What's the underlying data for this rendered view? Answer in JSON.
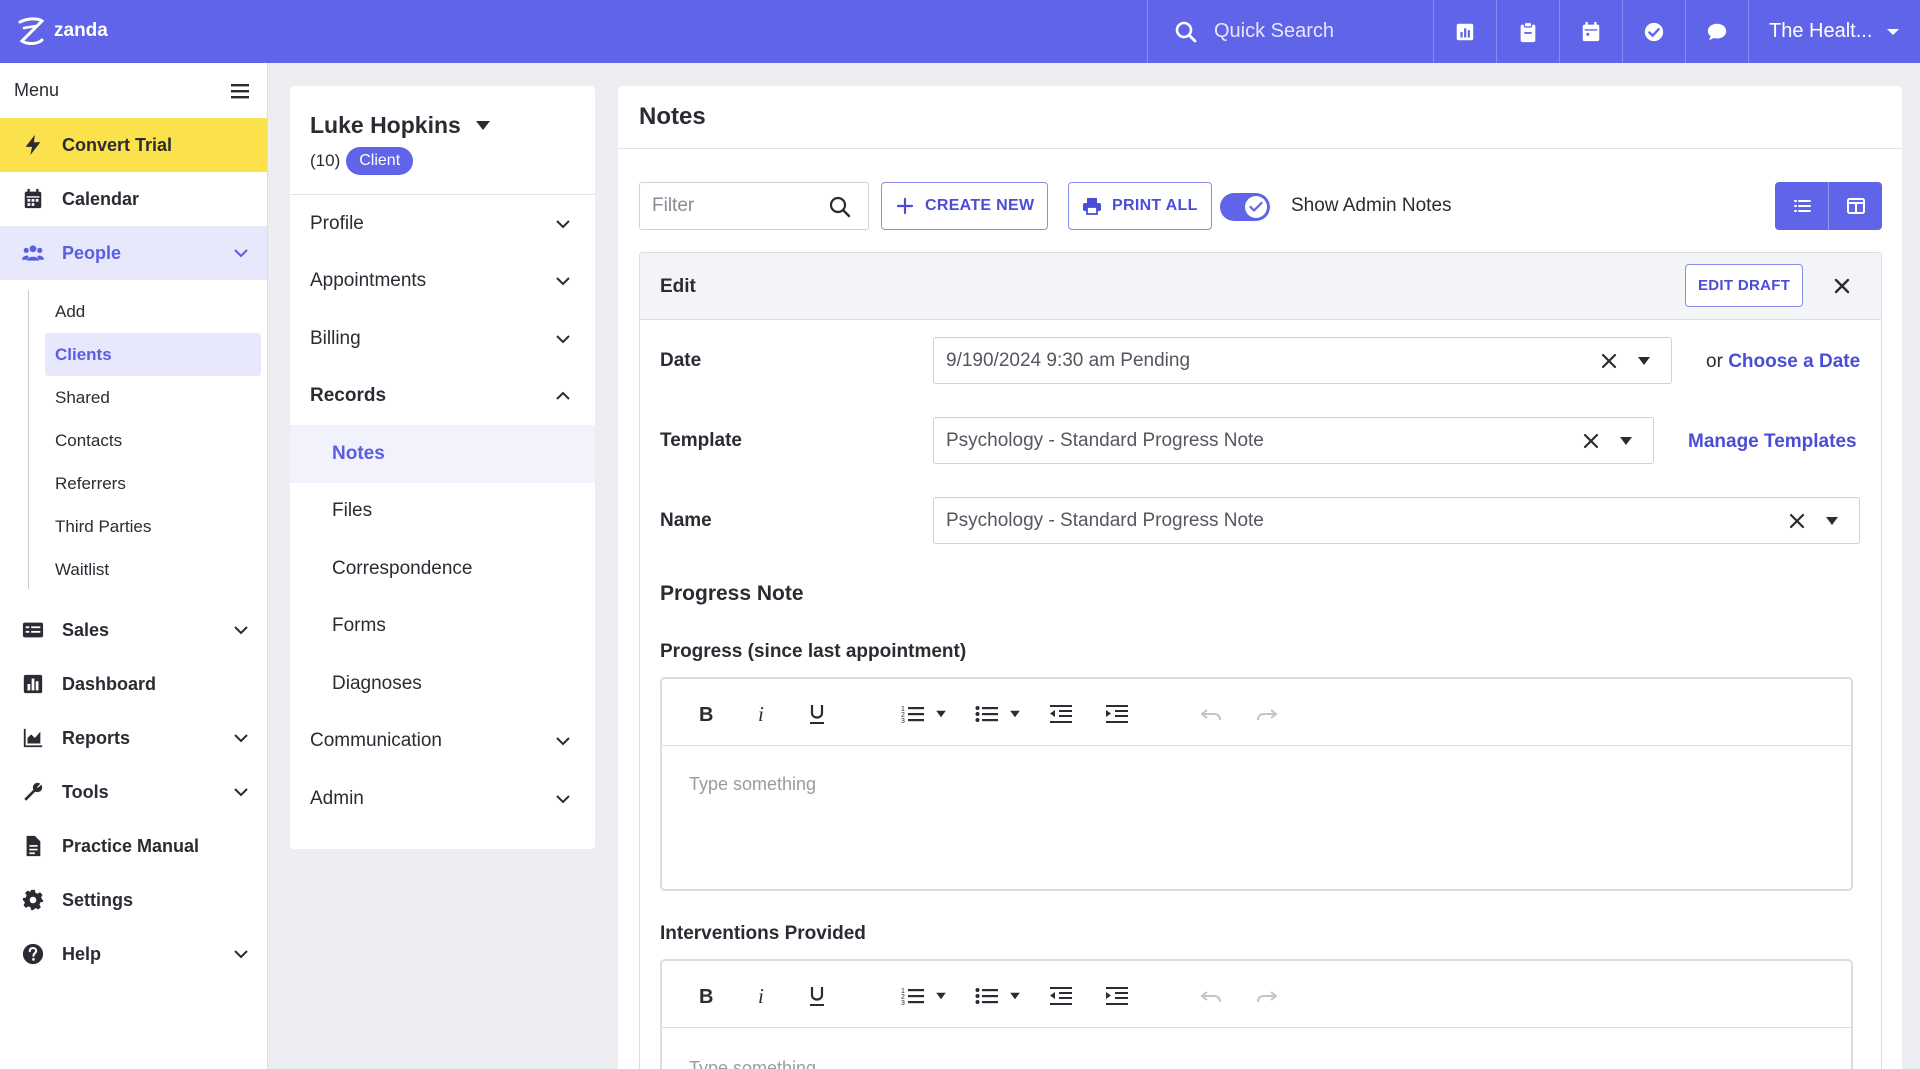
{
  "app": {
    "logo_text": "zanda",
    "account": "The Healt...",
    "accent": "#6064e8"
  },
  "topbar": {
    "search_placeholder": "Quick Search",
    "icons": [
      "reports-icon",
      "clipboard-icon",
      "calendar-icon",
      "check-icon",
      "chat-icon"
    ]
  },
  "sidebar": {
    "menu_label": "Menu",
    "items": {
      "convert_trial": "Convert Trial",
      "calendar": "Calendar",
      "people": "People",
      "sales": "Sales",
      "dashboard": "Dashboard",
      "reports": "Reports",
      "tools": "Tools",
      "practice_manual": "Practice Manual",
      "settings": "Settings",
      "help": "Help"
    },
    "people_sub": [
      "Add",
      "Clients",
      "Shared",
      "Contacts",
      "Referrers",
      "Third Parties",
      "Waitlist"
    ]
  },
  "client": {
    "name": "Luke Hopkins",
    "count": "(10)",
    "badge": "Client"
  },
  "records_nav": {
    "profile": "Profile",
    "appointments": "Appointments",
    "billing": "Billing",
    "records": "Records",
    "records_sub": [
      "Notes",
      "Files",
      "Correspondence",
      "Forms",
      "Diagnoses"
    ],
    "communication": "Communication",
    "admin": "Admin"
  },
  "notes": {
    "title": "Notes",
    "filter_placeholder": "Filter",
    "create_new": "CREATE NEW",
    "print_all": "PRINT ALL",
    "show_admin_notes": "Show Admin Notes",
    "show_admin_notes_on": true,
    "edit": {
      "title": "Edit",
      "edit_draft": "EDIT DRAFT",
      "date_label": "Date",
      "date_value": "9/190/2024 9:30 am Pending",
      "or_text": "or",
      "choose_date": "Choose a Date",
      "template_label": "Template",
      "template_value": "Psychology - Standard Progress Note",
      "manage_templates": "Manage Templates",
      "name_label": "Name",
      "name_value": "Psychology - Standard Progress Note",
      "section_title": "Progress Note",
      "field1_label": "Progress (since last appointment)",
      "field1_placeholder": "Type something",
      "field2_label": "Interventions Provided",
      "field2_placeholder": "Type something"
    }
  }
}
